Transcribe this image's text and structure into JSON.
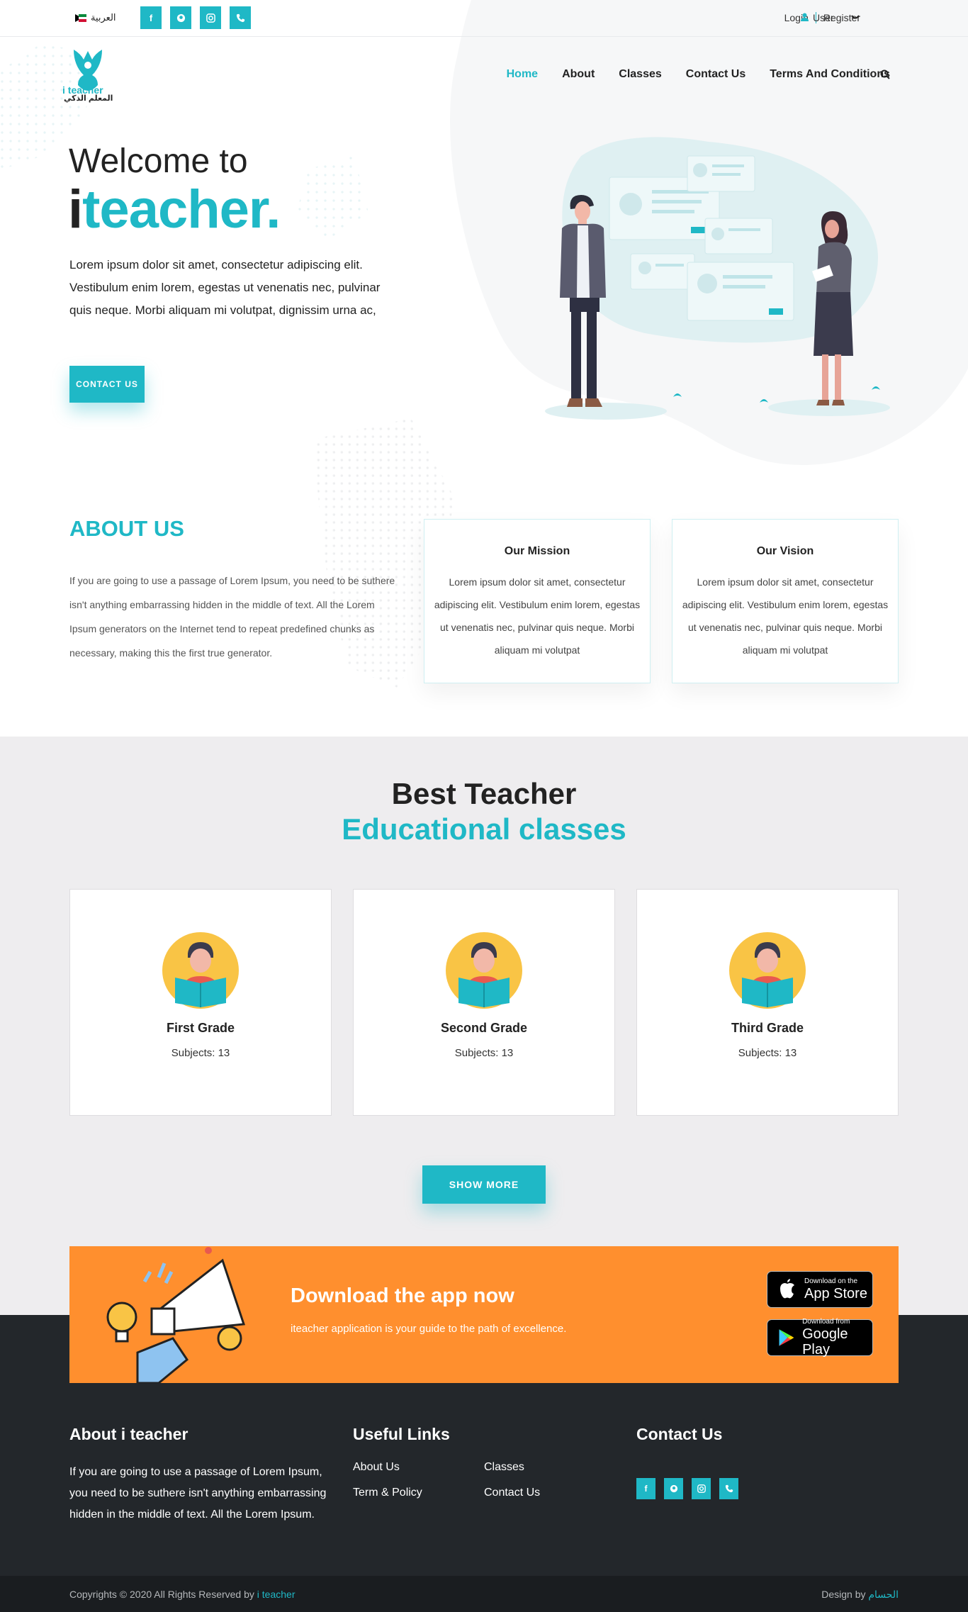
{
  "topbar": {
    "language_label": "العربية",
    "social_icons": [
      "facebook-icon",
      "snapchat-icon",
      "instagram-icon",
      "phone-icon"
    ],
    "login_label": "Login",
    "register_label": "Register",
    "user_label": "User"
  },
  "brand": {
    "logo_text": "i teacher",
    "logo_text_ar": "المعلم الذكي"
  },
  "nav": {
    "items": [
      "Home",
      "About",
      "Classes",
      "Contact Us",
      "Terms And Conditions"
    ],
    "active": "Home"
  },
  "hero": {
    "welcome": "Welcome to",
    "brand_first": "i",
    "brand_rest": "teacher.",
    "description": "Lorem ipsum dolor sit amet, consectetur adipiscing elit. Vestibulum enim lorem, egestas ut venenatis nec, pulvinar quis neque. Morbi aliquam mi volutpat, dignissim urna ac,",
    "cta_label": "CONTACT US"
  },
  "about": {
    "title": "ABOUT US",
    "text": "If you are going to use a passage of Lorem Ipsum, you need to be suthere isn't anything embarrassing hidden in the middle of text. All the Lorem Ipsum generators on the Internet tend to repeat predefined chunks as necessary, making this the first true generator.",
    "cards": [
      {
        "title": "Our Mission",
        "text": "Lorem ipsum dolor sit amet, consectetur adipiscing elit. Vestibulum enim lorem, egestas ut venenatis nec, pulvinar quis neque. Morbi aliquam mi volutpat"
      },
      {
        "title": "Our Vision",
        "text": "Lorem ipsum dolor sit amet, consectetur adipiscing elit. Vestibulum enim lorem, egestas ut venenatis nec, pulvinar quis neque. Morbi aliquam mi volutpat"
      }
    ]
  },
  "classes": {
    "heading": "Best Teacher",
    "subheading": "Educational classes",
    "grades": [
      {
        "name": "First Grade",
        "subjects": "Subjects: 13"
      },
      {
        "name": "Second Grade",
        "subjects": "Subjects: 13"
      },
      {
        "name": "Third Grade",
        "subjects": "Subjects: 13"
      }
    ],
    "show_more_label": "SHOW MORE"
  },
  "app": {
    "title": "Download the app now",
    "subtitle": "iteacher application is your guide to the path of excellence.",
    "app_store_small": "Download on the",
    "app_store_big": "App Store",
    "google_play_small": "Download from",
    "google_play_big": "Google Play"
  },
  "footer": {
    "about_title": "About i teacher",
    "about_text": "If you are going to use a passage of Lorem Ipsum, you need to be suthere isn't anything embarrassing hidden in the middle of text. All the Lorem Ipsum.",
    "links_title": "Useful Links",
    "links": [
      "About Us",
      "Classes",
      "Term & Policy",
      "Contact Us"
    ],
    "contact_title": "Contact Us",
    "copyright_prefix": "Copyrights © 2020 All Rights Reserved by ",
    "copyright_brand": "i teacher",
    "design_prefix": "Design by ",
    "design_brand": "الحسام"
  },
  "colors": {
    "accent": "#1fb8c6",
    "orange": "#ff8f2e",
    "footer": "#23272b",
    "section_bg": "#eeedef"
  }
}
